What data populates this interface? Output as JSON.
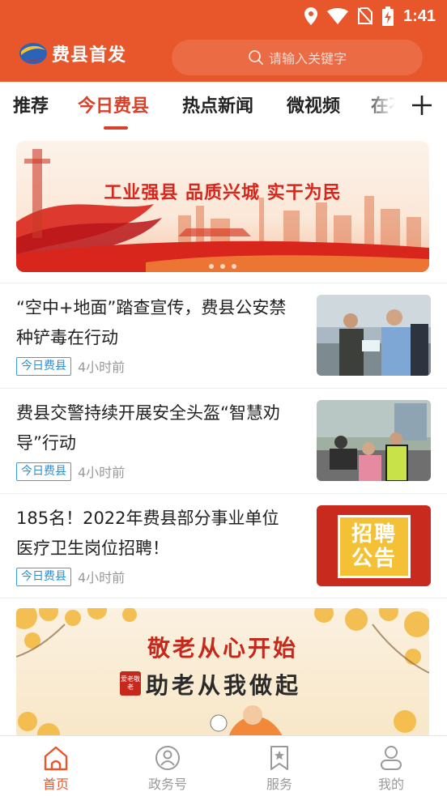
{
  "status_bar": {
    "time": "1:41",
    "icons": [
      "location-icon",
      "wifi-icon",
      "no-sim-icon",
      "battery-charging-icon"
    ]
  },
  "header": {
    "app_name": "费县首发",
    "search_placeholder": "请输入关键字",
    "brand_color": "#e8572b"
  },
  "tabs": {
    "items": [
      "推荐",
      "今日费县",
      "热点新闻",
      "微视频",
      "在不"
    ],
    "active_index": 1,
    "active_color": "#d9402a",
    "add_icon": "plus-icon"
  },
  "banner": {
    "slogan": "工业强县 品质兴城 实干为民",
    "page_count": 3
  },
  "news": [
    {
      "title": "“空中+地面”踏查宣传，费县公安禁种铲毒在行动",
      "tag": "今日费县",
      "time": "4小时前",
      "thumb": "police-photo"
    },
    {
      "title": "费县交警持续开展安全头盔“智慧劝导”行动",
      "tag": "今日费县",
      "time": "4小时前",
      "thumb": "traffic-police-photo"
    },
    {
      "title": "185名！2022年费县部分事业单位医疗卫生岗位招聘！",
      "tag": "今日费县",
      "time": "4小时前",
      "thumb_text_1": "招聘",
      "thumb_text_2": "公告"
    }
  ],
  "banner2": {
    "title": "敬老从心开始",
    "subtitle": "助老从我做起",
    "seal_text": "爱老敬老"
  },
  "bottom_nav": {
    "items": [
      {
        "label": "首页",
        "icon": "home-icon"
      },
      {
        "label": "政务号",
        "icon": "gov-account-icon"
      },
      {
        "label": "服务",
        "icon": "service-bookmark-icon"
      },
      {
        "label": "我的",
        "icon": "user-icon"
      }
    ],
    "active_index": 0
  }
}
